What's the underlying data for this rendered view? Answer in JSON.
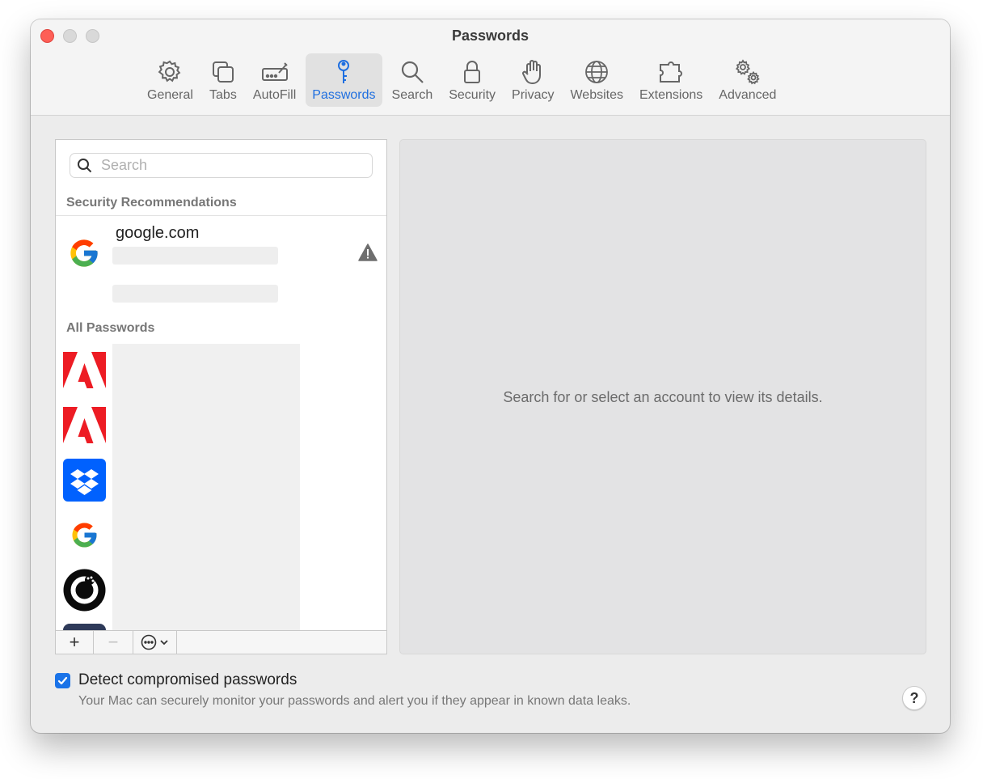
{
  "window": {
    "title": "Passwords"
  },
  "toolbar": {
    "items": [
      {
        "label": "General",
        "icon": "gear-icon"
      },
      {
        "label": "Tabs",
        "icon": "tabs-icon"
      },
      {
        "label": "AutoFill",
        "icon": "autofill-icon"
      },
      {
        "label": "Passwords",
        "icon": "key-icon",
        "active": true
      },
      {
        "label": "Search",
        "icon": "search-icon"
      },
      {
        "label": "Security",
        "icon": "lock-icon"
      },
      {
        "label": "Privacy",
        "icon": "hand-icon"
      },
      {
        "label": "Websites",
        "icon": "globe-icon"
      },
      {
        "label": "Extensions",
        "icon": "puzzle-icon"
      },
      {
        "label": "Advanced",
        "icon": "gears-icon"
      }
    ],
    "active_color": "#1f6fe0"
  },
  "sidebar": {
    "search_placeholder": "Search",
    "security_heading": "Security Recommendations",
    "recommendation": {
      "site": "google.com",
      "username_blurred": "",
      "status_blurred": "",
      "icon": "warning-icon"
    },
    "all_heading": "All Passwords",
    "all_items": [
      {
        "logo": "adobe-logo",
        "site_blurred": "",
        "user_blurred": ""
      },
      {
        "logo": "adobe-logo",
        "site_blurred": "",
        "user_blurred": ""
      },
      {
        "logo": "dropbox-logo",
        "site_blurred": "",
        "user_blurred": ""
      },
      {
        "logo": "google-logo",
        "site_blurred": "",
        "user_blurred": ""
      },
      {
        "logo": "macpaw-logo",
        "site_blurred": "",
        "user_blurred": ""
      },
      {
        "logo": "generic-logo",
        "site_blurred": "",
        "user_blurred": ""
      }
    ],
    "footer": {
      "add_label": "+",
      "remove_label": "−"
    }
  },
  "detail": {
    "empty_message": "Search for or select an account to view its details."
  },
  "detect": {
    "checked": true,
    "label": "Detect compromised passwords",
    "help": "Your Mac can securely monitor your passwords and alert you if they appear in known data leaks."
  },
  "help_button": "?"
}
